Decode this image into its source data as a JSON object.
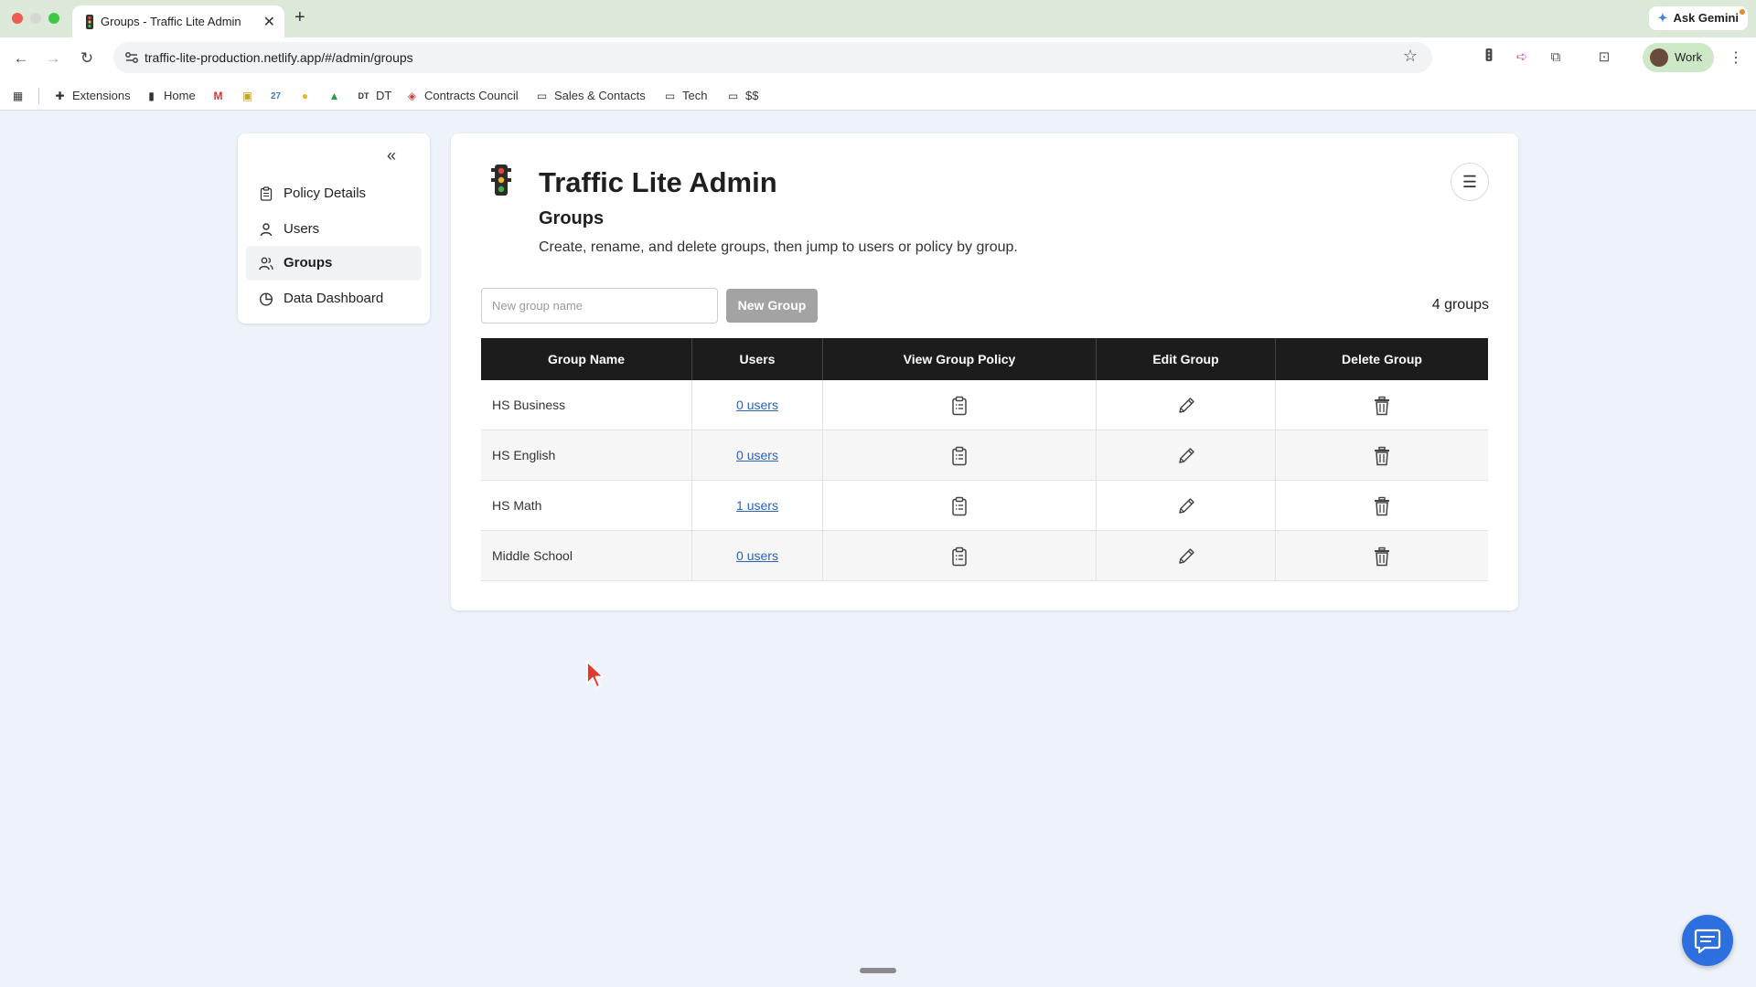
{
  "browser": {
    "tab_title": "Groups - Traffic Lite Admin",
    "tab_close": "✕",
    "new_tab": "+",
    "url": "traffic-lite-production.netlify.app/#/admin/groups",
    "ask_gemini": "Ask Gemini",
    "profile": "Work",
    "bookmarks": [
      {
        "label": "Extensions",
        "icon": "puzzle-icon"
      },
      {
        "label": "Home",
        "icon": "traffic-light-icon"
      },
      {
        "label": "",
        "icon": "gmail-icon"
      },
      {
        "label": "",
        "icon": "contacts-icon"
      },
      {
        "label": "",
        "icon": "calendar-icon"
      },
      {
        "label": "",
        "icon": "lightbulb-icon"
      },
      {
        "label": "",
        "icon": "drive-icon"
      },
      {
        "label": "DT",
        "icon": "dt-icon"
      },
      {
        "label": "Contracts Council",
        "icon": "contracts-icon"
      },
      {
        "label": "Sales & Contacts",
        "icon": "folder-icon"
      },
      {
        "label": "Tech",
        "icon": "folder-icon"
      },
      {
        "label": "$$",
        "icon": "folder-icon"
      }
    ]
  },
  "sidebar": {
    "collapse": "«",
    "items": [
      {
        "label": "Policy Details",
        "icon": "clipboard-icon",
        "active": false
      },
      {
        "label": "Users",
        "icon": "user-icon",
        "active": false
      },
      {
        "label": "Groups",
        "icon": "users-icon",
        "active": true
      },
      {
        "label": "Data Dashboard",
        "icon": "pie-chart-icon",
        "active": false
      }
    ]
  },
  "header": {
    "app_title": "Traffic Lite Admin",
    "section_title": "Groups",
    "section_desc": "Create, rename, and delete groups, then jump to users or policy by group.",
    "menu_icon": "☰"
  },
  "toolbar": {
    "input_placeholder": "New group name",
    "input_value": "",
    "new_group_label": "New Group",
    "group_count": "4 groups"
  },
  "table": {
    "columns": [
      "Group Name",
      "Users",
      "View Group Policy",
      "Edit Group",
      "Delete Group"
    ],
    "rows": [
      {
        "name": "HS Business",
        "users": "0 users"
      },
      {
        "name": "HS English",
        "users": "0 users"
      },
      {
        "name": "HS Math",
        "users": "1 users"
      },
      {
        "name": "Middle School",
        "users": "0 users"
      }
    ]
  },
  "colors": {
    "accent": "#2e6fe0",
    "table_header": "#1c1c1c",
    "button_disabled": "#a3a3a3",
    "link": "#2a62b8",
    "page_bg": "#eef2fa"
  }
}
